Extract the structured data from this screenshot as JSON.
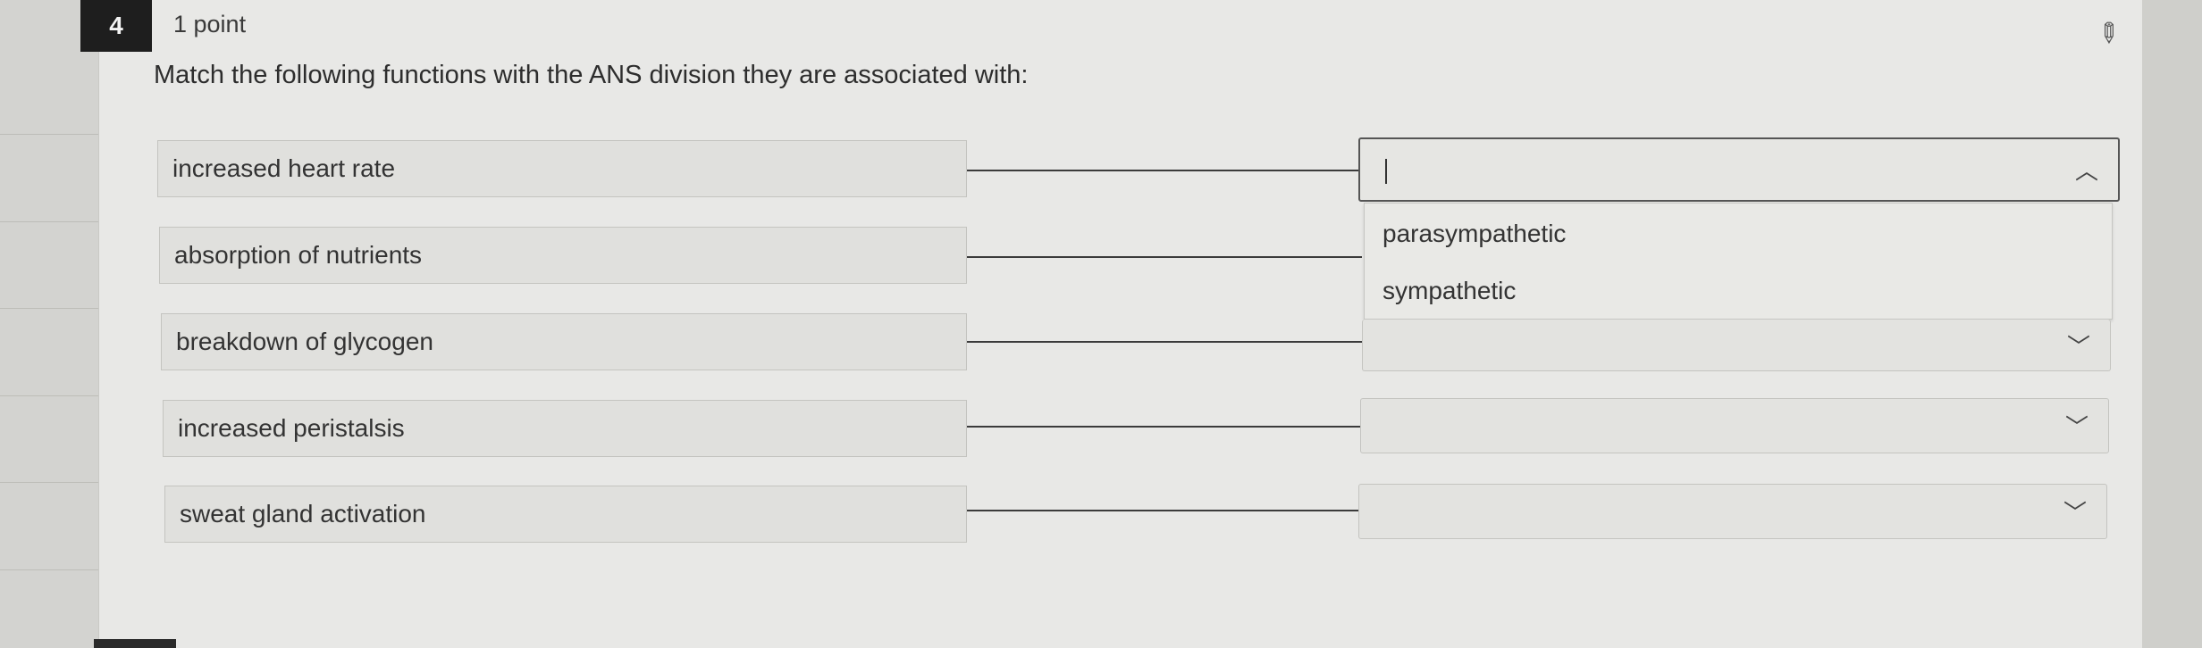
{
  "question": {
    "number": "4",
    "points": "1 point",
    "prompt": "Match the following functions with the ANS division they are associated with:"
  },
  "icons": {
    "pin": "pin-icon",
    "chevron_up": "chevron-up-icon",
    "chevron_down": "chevron-down-icon"
  },
  "matches": [
    {
      "term": "increased heart rate",
      "selected": "",
      "state": "open"
    },
    {
      "term": "absorption of nutrients",
      "selected": ""
    },
    {
      "term": "breakdown of glycogen",
      "selected": ""
    },
    {
      "term": "increased peristalsis",
      "selected": ""
    },
    {
      "term": "sweat gland activation",
      "selected": ""
    }
  ],
  "dropdown": {
    "options": [
      "parasympathetic",
      "sympathetic"
    ]
  }
}
